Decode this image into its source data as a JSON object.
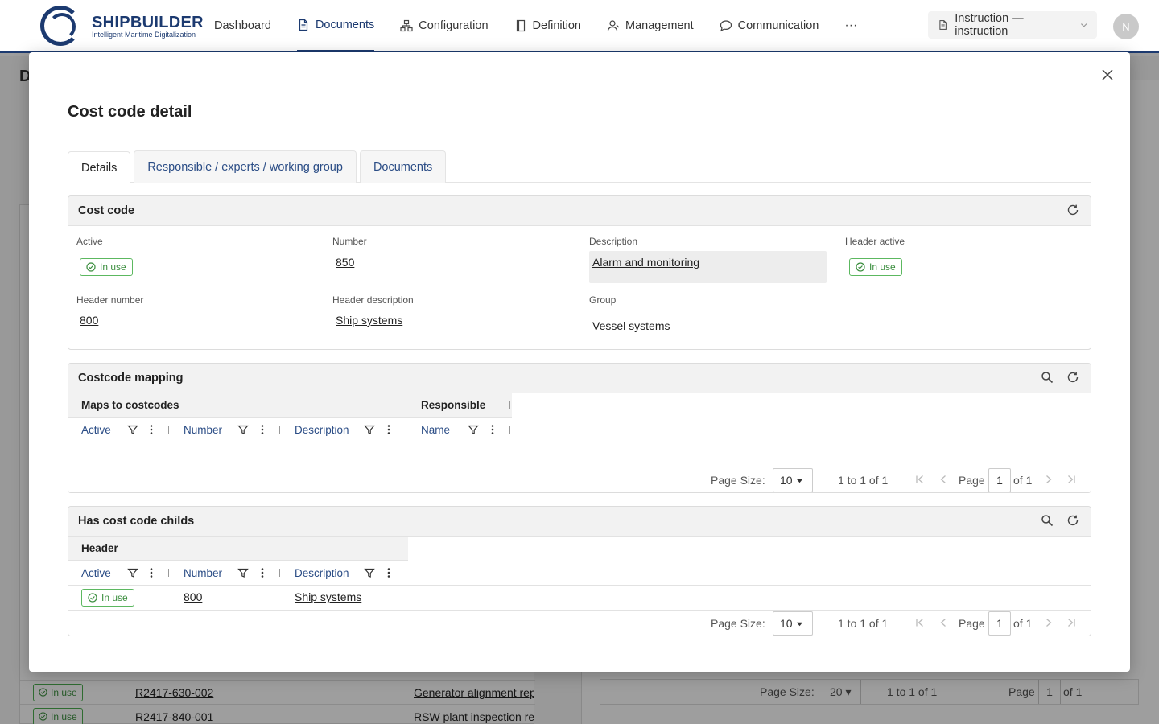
{
  "app": {
    "brand": "SHIPBUILDER",
    "tagline": "Intelligent Maritime Digitalization",
    "nav": [
      {
        "label": "Dashboard",
        "icon": "none"
      },
      {
        "label": "Documents",
        "icon": "document-icon"
      },
      {
        "label": "Configuration",
        "icon": "sitemap-icon"
      },
      {
        "label": "Definition",
        "icon": "book-icon"
      },
      {
        "label": "Management",
        "icon": "user-icon"
      },
      {
        "label": "Communication",
        "icon": "chat-icon"
      }
    ],
    "active_nav": "Documents",
    "more": "···",
    "context_select": "Instruction — instruction",
    "avatar_initial": "N"
  },
  "background": {
    "title_initial": "D",
    "rows": [
      {
        "status": "In use",
        "number": "R2417-630-002",
        "description": "Generator alignment rep"
      },
      {
        "status": "In use",
        "number": "R2417-840-001",
        "description": "RSW plant inspection re"
      }
    ],
    "pager": {
      "page_size_label": "Page Size:",
      "page_size": "20",
      "range": "1 to 1 of 1",
      "page_label": "Page",
      "page": "1",
      "of": "of 1"
    }
  },
  "modal": {
    "title": "Cost code detail",
    "tabs": [
      "Details",
      "Responsible / experts / working group",
      "Documents"
    ],
    "active_tab": "Details",
    "cost_code": {
      "title": "Cost code",
      "active_label": "Active",
      "active_value": "In use",
      "number_label": "Number",
      "number_value": "850",
      "description_label": "Description",
      "description_value": "Alarm and monitoring",
      "header_active_label": "Header active",
      "header_active_value": "In use",
      "header_number_label": "Header number",
      "header_number_value": "800",
      "header_description_label": "Header description",
      "header_description_value": "Ship systems",
      "group_label": "Group",
      "group_value": "Vessel systems"
    },
    "mapping": {
      "title": "Costcode mapping",
      "group_maps": "Maps to costcodes",
      "group_responsible": "Responsible",
      "columns": [
        "Active",
        "Number",
        "Description",
        "Name"
      ],
      "pager": {
        "page_size_label": "Page Size:",
        "page_size": "10",
        "range": "1 to 1 of 1",
        "page_label": "Page",
        "page": "1",
        "of": "of 1"
      }
    },
    "childs": {
      "title": "Has cost code childs",
      "group_header": "Header",
      "columns": [
        "Active",
        "Number",
        "Description"
      ],
      "row": {
        "status": "In use",
        "number": "800",
        "description": "Ship systems"
      },
      "pager": {
        "page_size_label": "Page Size:",
        "page_size": "10",
        "range": "1 to 1 of 1",
        "page_label": "Page",
        "page": "1",
        "of": "of 1"
      }
    }
  }
}
